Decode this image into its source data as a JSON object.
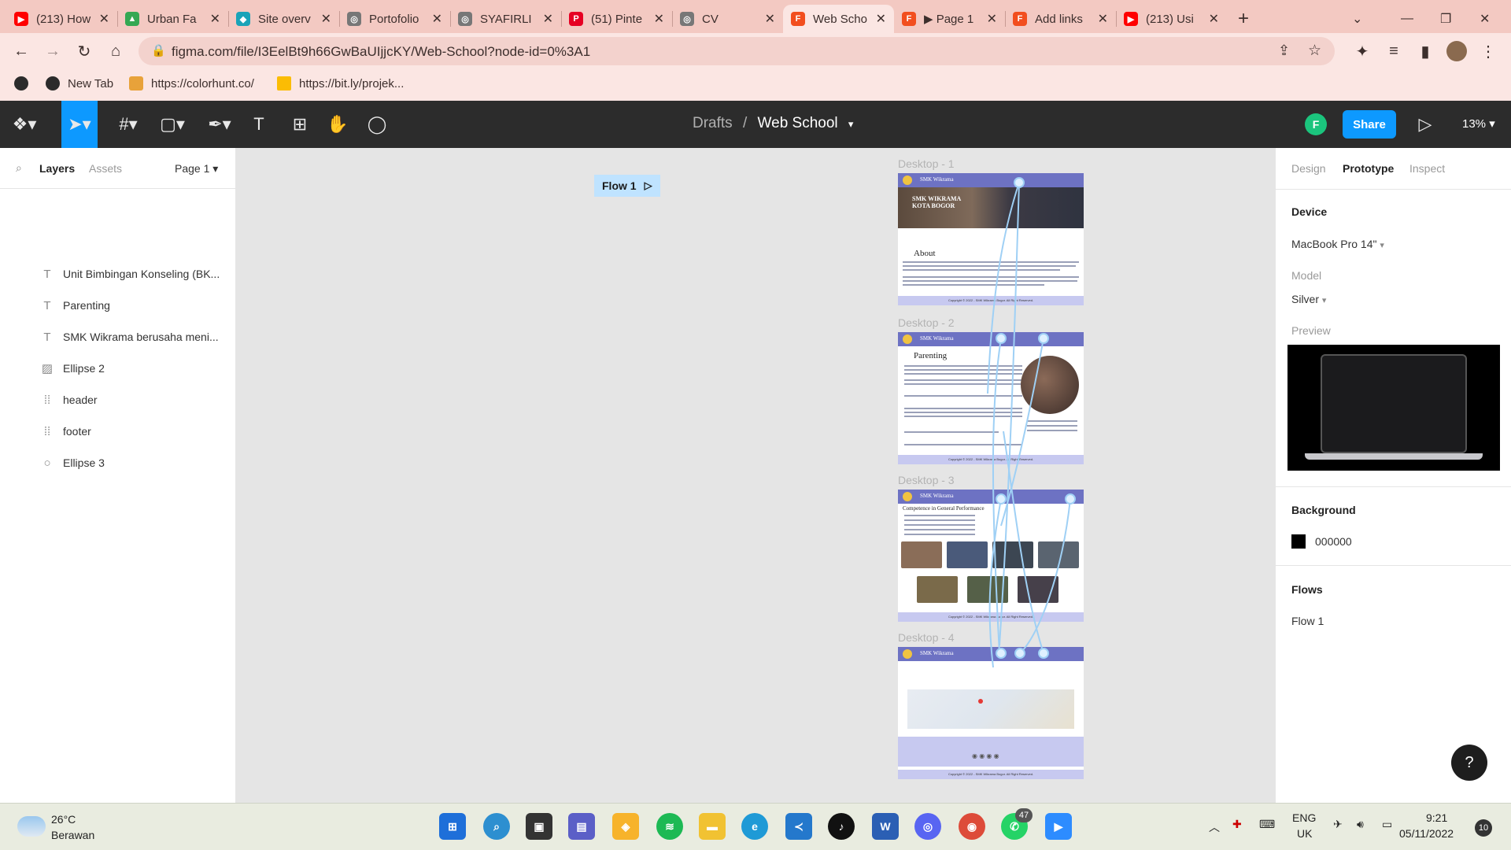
{
  "browser": {
    "tabs": [
      {
        "title": "(213) How",
        "color": "#ff0000",
        "glyph": "▶"
      },
      {
        "title": "Urban Fa",
        "color": "#34a853",
        "glyph": "▲"
      },
      {
        "title": "Site overv",
        "color": "#1aa3b8",
        "glyph": "◆"
      },
      {
        "title": "Portofolio",
        "color": "#777777",
        "glyph": "◎"
      },
      {
        "title": "SYAFIRLI",
        "color": "#777777",
        "glyph": "◎"
      },
      {
        "title": "(51) Pinte",
        "color": "#e60023",
        "glyph": "P"
      },
      {
        "title": "CV",
        "color": "#777777",
        "glyph": "◎"
      },
      {
        "title": "Web Scho",
        "color": "#f24e1e",
        "glyph": "F"
      },
      {
        "title": "▶ Page 1",
        "color": "#f24e1e",
        "glyph": "F"
      },
      {
        "title": "Add links",
        "color": "#f24e1e",
        "glyph": "F"
      },
      {
        "title": "(213) Usi",
        "color": "#ff0000",
        "glyph": "▶"
      }
    ],
    "active_tab_index": 7,
    "url": "figma.com/file/I3EelBt9h66GwBaUIjjcKY/Web-School?node-id=0%3A1",
    "bookmarks": [
      "New Tab",
      "https://colorhunt.co/",
      "https://bit.ly/projek..."
    ]
  },
  "figma": {
    "breadcrumb_drafts": "Drafts",
    "breadcrumb_sep": "/",
    "file_name": "Web School",
    "share_label": "Share",
    "avatar_letter": "F",
    "zoom": "13%",
    "left_tabs": {
      "layers": "Layers",
      "assets": "Assets",
      "page": "Page 1"
    },
    "layers": [
      {
        "name": "Desktop - 1",
        "type": "frame",
        "icon": "#"
      },
      {
        "name": "Desktop - 2",
        "type": "frame",
        "icon": "#"
      },
      {
        "name": "Unit Bimbingan Konseling (BK...",
        "type": "text",
        "icon": "T"
      },
      {
        "name": "Parenting",
        "type": "text",
        "icon": "T"
      },
      {
        "name": "SMK Wikrama berusaha meni...",
        "type": "text",
        "icon": "T"
      },
      {
        "name": "Ellipse 2",
        "type": "image",
        "icon": "▨"
      },
      {
        "name": "header",
        "type": "group",
        "icon": "⁞⁞"
      },
      {
        "name": "footer",
        "type": "group",
        "icon": "⁞⁞"
      },
      {
        "name": "Ellipse 3",
        "type": "ellipse",
        "icon": "○"
      },
      {
        "name": "Desktop - 3",
        "type": "frame",
        "icon": "#"
      },
      {
        "name": "Desktop - 4",
        "type": "frame",
        "icon": "#"
      }
    ],
    "canvas": {
      "flow_label": "Flow 1",
      "frame_labels": [
        "Desktop - 1",
        "Desktop - 2",
        "Desktop - 3",
        "Desktop - 4"
      ],
      "site_brand": "SMK Wikrama",
      "hero_text": "SMK WIKRAMA KOTA BOGOR",
      "heading_about": "About",
      "heading_parenting": "Parenting",
      "heading_competence": "Competence in General Performance",
      "footer_text": "Copyright © 2022 - SMK Wikrama Bogor. All Right Reserved."
    },
    "right_panel": {
      "tabs": [
        "Design",
        "Prototype",
        "Inspect"
      ],
      "active_tab": "Prototype",
      "device_heading": "Device",
      "device": "MacBook Pro 14\"",
      "model_label": "Model",
      "model": "Silver",
      "preview_label": "Preview",
      "background_heading": "Background",
      "background_value": "000000",
      "flows_heading": "Flows",
      "flow_item": "Flow 1"
    },
    "help": "?"
  },
  "taskbar": {
    "weather_temp": "26°C",
    "weather_desc": "Berawan",
    "lang_top": "ENG",
    "lang_bottom": "UK",
    "time": "9:21",
    "date": "05/11/2022",
    "notif_count": "10",
    "whatsapp_badge": "47"
  }
}
